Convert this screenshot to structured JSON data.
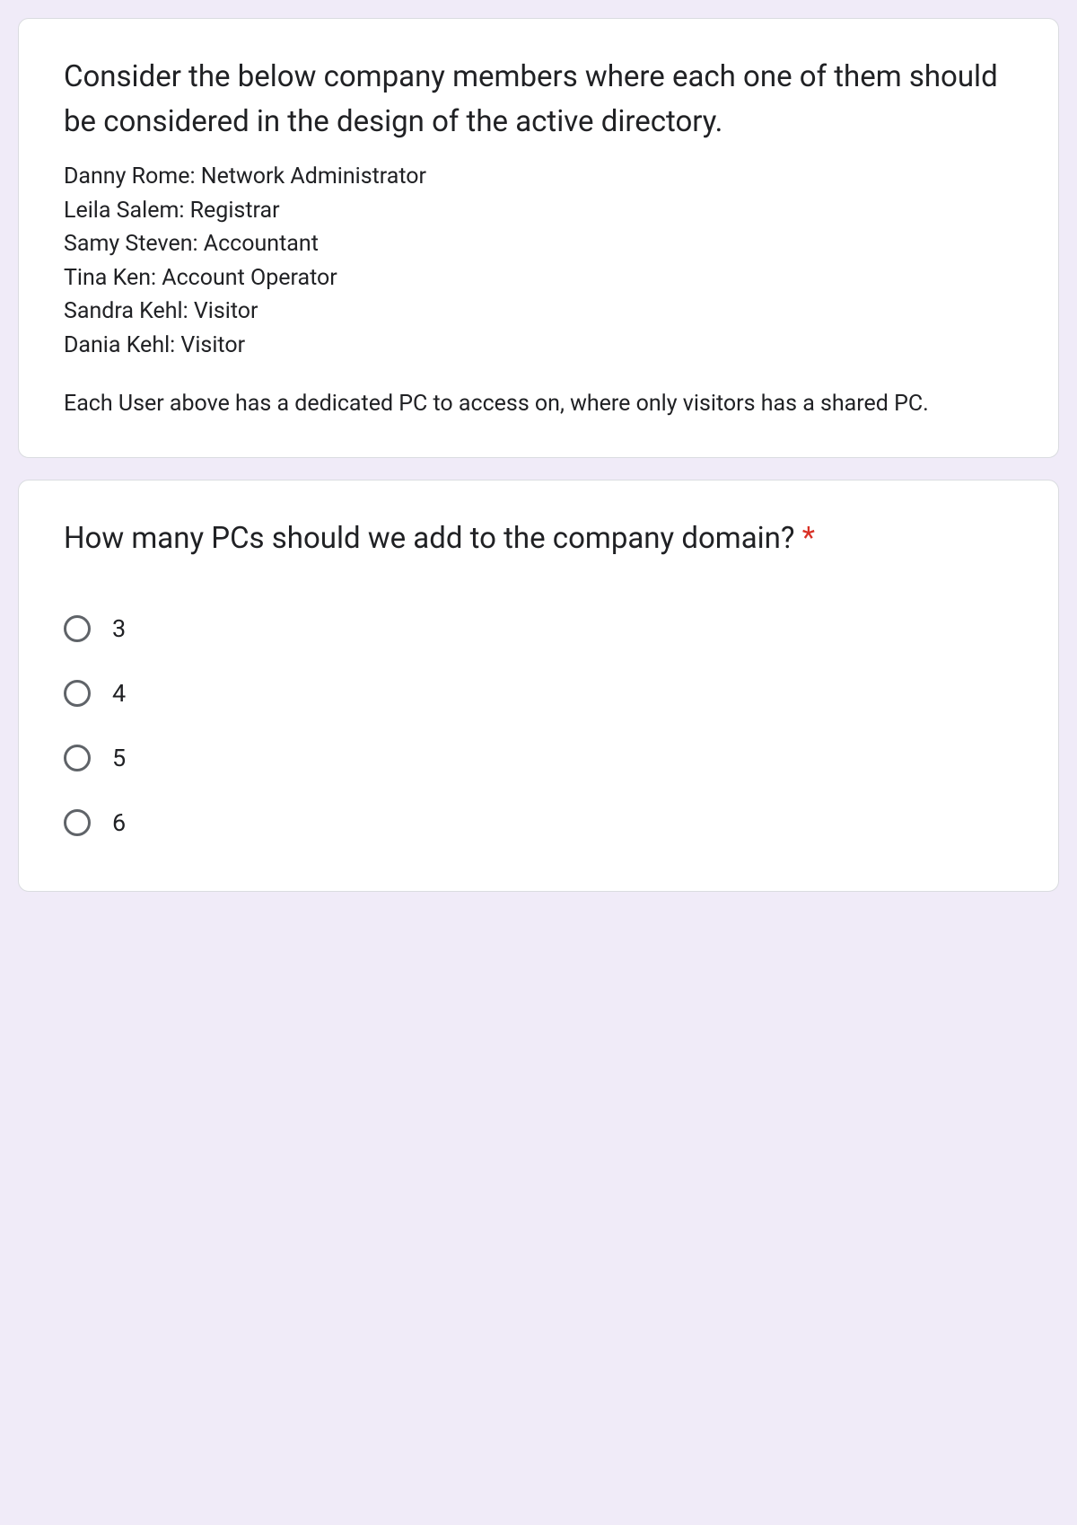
{
  "question1": {
    "title": "Consider the below company members where each one of them should be considered in the design of the active directory.",
    "members": [
      "Danny Rome: Network Administrator",
      "Leila Salem: Registrar",
      "Samy Steven: Accountant",
      "Tina Ken: Account Operator",
      "Sandra Kehl: Visitor",
      "Dania Kehl: Visitor"
    ],
    "note": "Each User above has a dedicated PC to access on, where only visitors has a shared PC."
  },
  "question2": {
    "title": "How many PCs should we add to the company domain? ",
    "required_mark": "*",
    "options": [
      "3",
      "4",
      "5",
      "6"
    ]
  }
}
